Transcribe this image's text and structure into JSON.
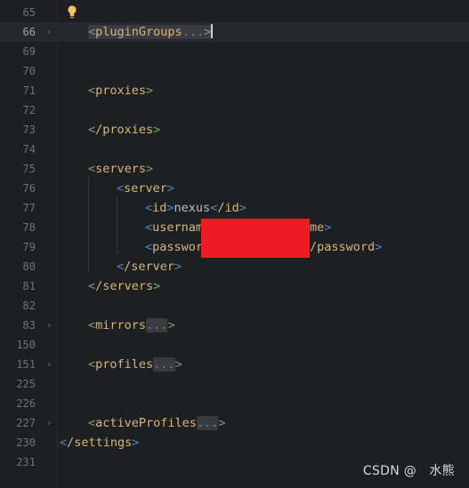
{
  "lines": [
    {
      "num": "65"
    },
    {
      "num": "66",
      "tag": "pluginGroups"
    },
    {
      "num": "69"
    },
    {
      "num": "70"
    },
    {
      "num": "71",
      "tag": "proxies"
    },
    {
      "num": "72"
    },
    {
      "num": "73",
      "tag": "/proxies"
    },
    {
      "num": "74"
    },
    {
      "num": "75",
      "tag": "servers"
    },
    {
      "num": "76",
      "tag": "server"
    },
    {
      "num": "77",
      "tag": "id",
      "value": "nexus",
      "close": "/id"
    },
    {
      "num": "78",
      "tag": "usernam",
      "tail": "me"
    },
    {
      "num": "79",
      "tag": "passwor",
      "tail": "/password"
    },
    {
      "num": "80",
      "tag": "/server"
    },
    {
      "num": "81",
      "tag": "/servers"
    },
    {
      "num": "82"
    },
    {
      "num": "83",
      "tag": "mirrors"
    },
    {
      "num": "150"
    },
    {
      "num": "151",
      "tag": "profiles"
    },
    {
      "num": "225"
    },
    {
      "num": "226"
    },
    {
      "num": "227",
      "tag": "activeProfiles"
    },
    {
      "num": "230",
      "tag": "/settings"
    },
    {
      "num": "231"
    }
  ],
  "folded_ellipsis": "...",
  "icons": {
    "intention": "lightbulb-icon",
    "fold": "chevron-right-icon"
  },
  "redaction_color": "#ed1c24",
  "watermark": "CSDN @　水熊",
  "colors": {
    "background": "#1e1f22",
    "tag": "#d5b778",
    "text": "#bcbec4",
    "line_number": "#6f737a"
  }
}
